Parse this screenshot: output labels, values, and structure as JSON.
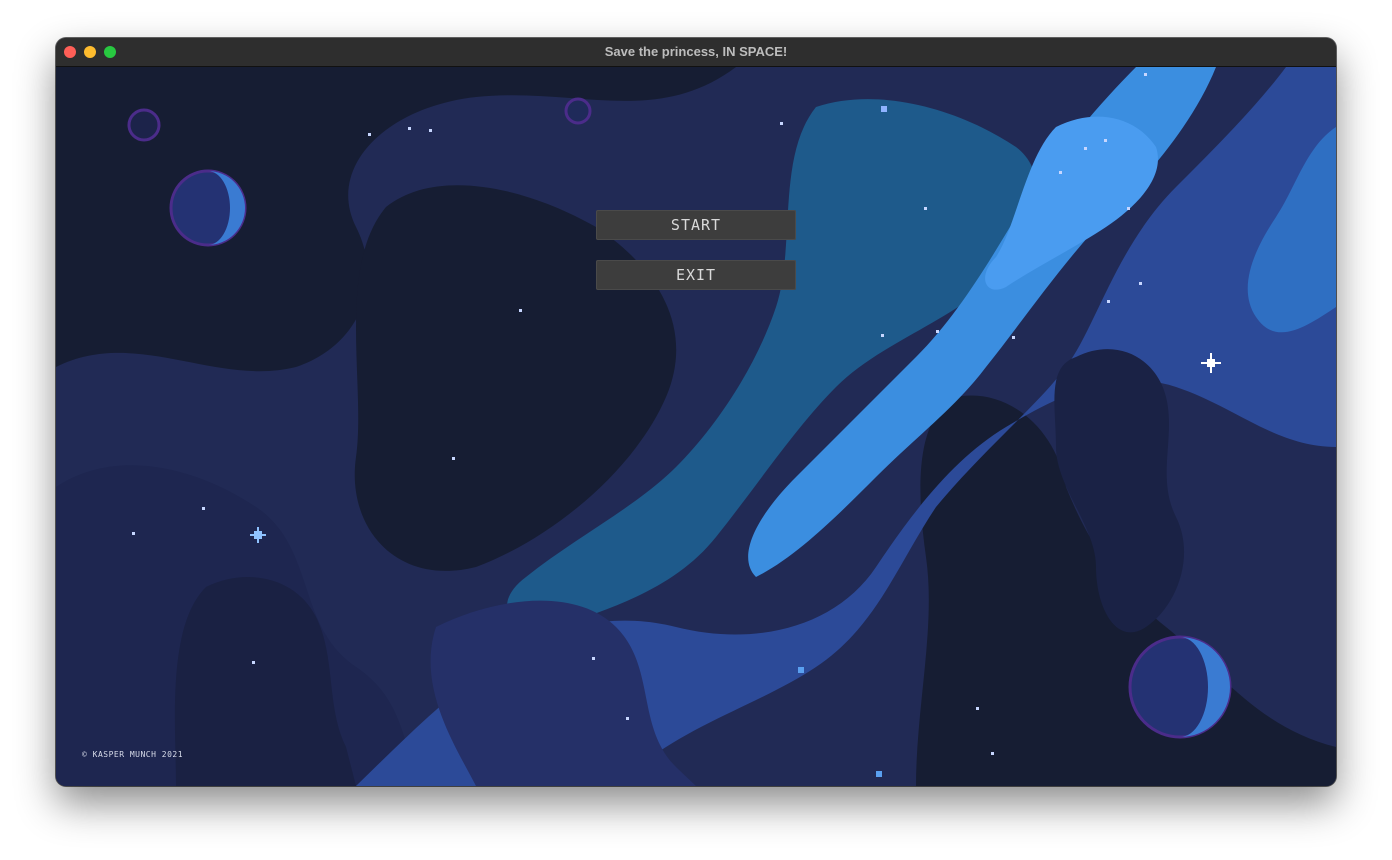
{
  "window": {
    "title": "Save the princess, IN SPACE!"
  },
  "menu": {
    "start_label": "START",
    "exit_label": "EXIT"
  },
  "footer": {
    "copyright": "© KASPER MUNCH 2021"
  },
  "colors": {
    "space_dark": "#161d33",
    "nebula_navy": "#222b57",
    "nebula_blue": "#2d4b9a",
    "nebula_teal": "#1f5b8c",
    "nebula_light": "#3b8ee0",
    "button_bg": "#3d3d3d",
    "button_text": "#d9d9d9",
    "planet_rim": "#4b2c8a"
  }
}
